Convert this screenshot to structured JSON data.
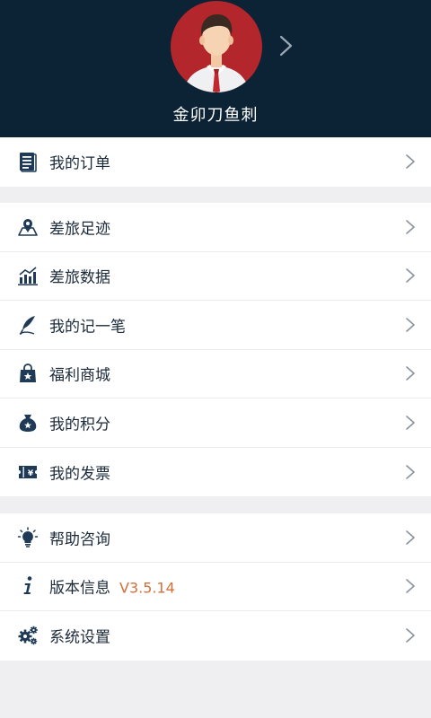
{
  "profile": {
    "username": "金卯刀鱼刺"
  },
  "groups": [
    {
      "items": [
        {
          "id": "orders",
          "label": "我的订单",
          "icon": "orders-list-icon"
        }
      ]
    },
    {
      "items": [
        {
          "id": "travel-footprint",
          "label": "差旅足迹",
          "icon": "map-pin-icon"
        },
        {
          "id": "travel-data",
          "label": "差旅数据",
          "icon": "bar-chart-icon"
        },
        {
          "id": "notes",
          "label": "我的记一笔",
          "icon": "quill-icon"
        },
        {
          "id": "welfare-mall",
          "label": "福利商城",
          "icon": "shopping-bag-icon"
        },
        {
          "id": "points",
          "label": "我的积分",
          "icon": "money-bag-icon"
        },
        {
          "id": "invoices",
          "label": "我的发票",
          "icon": "invoice-ticket-icon"
        }
      ]
    },
    {
      "items": [
        {
          "id": "help",
          "label": "帮助咨询",
          "icon": "lightbulb-icon"
        },
        {
          "id": "version",
          "label": "版本信息",
          "icon": "info-icon",
          "value": "V3.5.14"
        },
        {
          "id": "settings",
          "label": "系统设置",
          "icon": "gears-icon"
        }
      ]
    }
  ],
  "colors": {
    "header_bg": "#0c2235",
    "icon": "#1f3a57",
    "version_text": "#d2703a",
    "avatar_bg": "#b3262b"
  }
}
